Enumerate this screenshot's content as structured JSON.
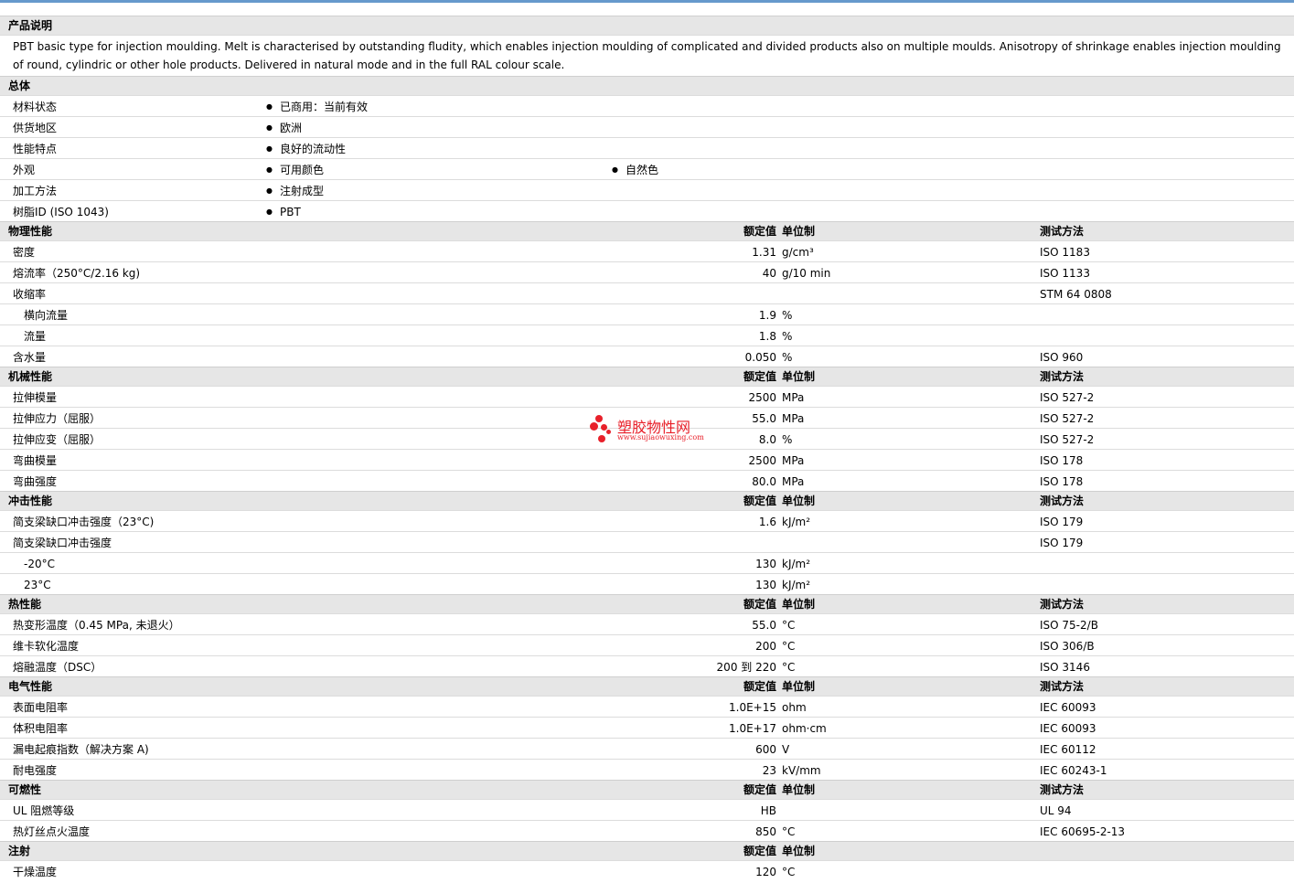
{
  "headers": {
    "value": "额定值",
    "unit": "单位制",
    "test": "测试方法"
  },
  "desc": {
    "title": "产品说明",
    "text": "PBT basic type for injection moulding. Melt is characterised by outstanding fludity, which enables injection moulding of complicated and divided products also on multiple moulds. Anisotropy of shrinkage enables injection moulding of round, cylindric or other hole products. Delivered in natural mode and in the full RAL colour scale."
  },
  "general": {
    "title": "总体",
    "rows": [
      {
        "name": "材料状态",
        "v1": "已商用：当前有效",
        "v2": ""
      },
      {
        "name": "供货地区",
        "v1": "欧洲",
        "v2": ""
      },
      {
        "name": "性能特点",
        "v1": "良好的流动性",
        "v2": ""
      },
      {
        "name": "外观",
        "v1": "可用颜色",
        "v2": "自然色"
      },
      {
        "name": "加工方法",
        "v1": "注射成型",
        "v2": ""
      },
      {
        "name": "树脂ID (ISO 1043)",
        "v1": "PBT",
        "v2": ""
      }
    ]
  },
  "physical": {
    "title": "物理性能",
    "rows": [
      {
        "name": "密度",
        "value": "1.31",
        "unit": "g/cm³",
        "test": "ISO 1183",
        "sub": false
      },
      {
        "name": "熔流率（250°C/2.16 kg)",
        "value": "40",
        "unit": "g/10 min",
        "test": "ISO 1133",
        "sub": false
      },
      {
        "name": "收缩率",
        "value": "",
        "unit": "",
        "test": "STM 64 0808",
        "sub": false
      },
      {
        "name": "横向流量",
        "value": "1.9",
        "unit": "%",
        "test": "",
        "sub": true
      },
      {
        "name": "流量",
        "value": "1.8",
        "unit": "%",
        "test": "",
        "sub": true
      },
      {
        "name": "含水量",
        "value": "0.050",
        "unit": "%",
        "test": "ISO 960",
        "sub": false
      }
    ]
  },
  "mechanical": {
    "title": "机械性能",
    "rows": [
      {
        "name": "拉伸模量",
        "value": "2500",
        "unit": "MPa",
        "test": "ISO 527-2",
        "sub": false
      },
      {
        "name": "拉伸应力（屈服）",
        "value": "55.0",
        "unit": "MPa",
        "test": "ISO 527-2",
        "sub": false
      },
      {
        "name": "拉伸应变（屈服）",
        "value": "8.0",
        "unit": "%",
        "test": "ISO 527-2",
        "sub": false
      },
      {
        "name": "弯曲模量",
        "value": "2500",
        "unit": "MPa",
        "test": "ISO 178",
        "sub": false
      },
      {
        "name": "弯曲强度",
        "value": "80.0",
        "unit": "MPa",
        "test": "ISO 178",
        "sub": false
      }
    ]
  },
  "impact": {
    "title": "冲击性能",
    "rows": [
      {
        "name": "简支梁缺口冲击强度（23°C)",
        "value": "1.6",
        "unit": "kJ/m²",
        "test": "ISO 179",
        "sub": false
      },
      {
        "name": "简支梁缺口冲击强度",
        "value": "",
        "unit": "",
        "test": "ISO 179",
        "sub": false
      },
      {
        "name": "-20°C",
        "value": "130",
        "unit": "kJ/m²",
        "test": "",
        "sub": true
      },
      {
        "name": "23°C",
        "value": "130",
        "unit": "kJ/m²",
        "test": "",
        "sub": true
      }
    ]
  },
  "thermal": {
    "title": "热性能",
    "rows": [
      {
        "name": "热变形温度（0.45 MPa, 未退火）",
        "value": "55.0",
        "unit": "°C",
        "test": "ISO 75-2/B",
        "sub": false
      },
      {
        "name": "维卡软化温度",
        "value": "200",
        "unit": "°C",
        "test": "ISO 306/B",
        "sub": false
      },
      {
        "name": "熔融温度（DSC）",
        "value": "200 到 220",
        "unit": "°C",
        "test": "ISO 3146",
        "sub": false
      }
    ]
  },
  "electrical": {
    "title": "电气性能",
    "rows": [
      {
        "name": "表面电阻率",
        "value": "1.0E+15",
        "unit": "ohm",
        "test": "IEC 60093",
        "sub": false
      },
      {
        "name": "体积电阻率",
        "value": "1.0E+17",
        "unit": "ohm·cm",
        "test": "IEC 60093",
        "sub": false
      },
      {
        "name": "漏电起痕指数（解决方案 A)",
        "value": "600",
        "unit": "V",
        "test": "IEC 60112",
        "sub": false
      },
      {
        "name": "耐电强度",
        "value": "23",
        "unit": "kV/mm",
        "test": "IEC 60243-1",
        "sub": false
      }
    ]
  },
  "flammability": {
    "title": "可燃性",
    "rows": [
      {
        "name": "UL 阻燃等级",
        "value": "HB",
        "unit": "",
        "test": "UL 94",
        "sub": false
      },
      {
        "name": "热灯丝点火温度",
        "value": "850",
        "unit": "°C",
        "test": "IEC 60695-2-13",
        "sub": false
      }
    ]
  },
  "injection": {
    "title": "注射",
    "rows": [
      {
        "name": "干燥温度",
        "value": "120",
        "unit": "°C",
        "test": "",
        "sub": false
      }
    ]
  },
  "watermark": {
    "name": "塑胶物性网",
    "url": "www.sujiaowuxing.com"
  }
}
